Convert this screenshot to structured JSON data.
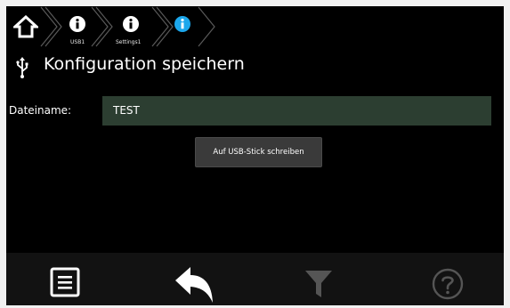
{
  "breadcrumb": {
    "items": [
      {
        "icon": "home-icon",
        "label": ""
      },
      {
        "icon": "info-icon",
        "label": "USB1"
      },
      {
        "icon": "info-icon",
        "label": "Settings1"
      },
      {
        "icon": "info-icon-active",
        "label": ""
      }
    ]
  },
  "header": {
    "icon": "usb-icon",
    "title": "Konfiguration speichern"
  },
  "form": {
    "filename_label": "Dateiname:",
    "filename_value": "TEST",
    "write_button_label": "Auf USB-Stick schreiben"
  },
  "bottom_bar": {
    "items": [
      {
        "icon": "list-icon",
        "enabled": true
      },
      {
        "icon": "back-arrow-icon",
        "enabled": true
      },
      {
        "icon": "filter-icon",
        "enabled": false
      },
      {
        "icon": "help-icon",
        "enabled": false
      }
    ]
  },
  "colors": {
    "screen_bg": "#000000",
    "input_bg": "#2c3e31",
    "button_bg": "#3a3a3a",
    "active_info": "#1ca7ec",
    "disabled_icon": "#555555"
  }
}
